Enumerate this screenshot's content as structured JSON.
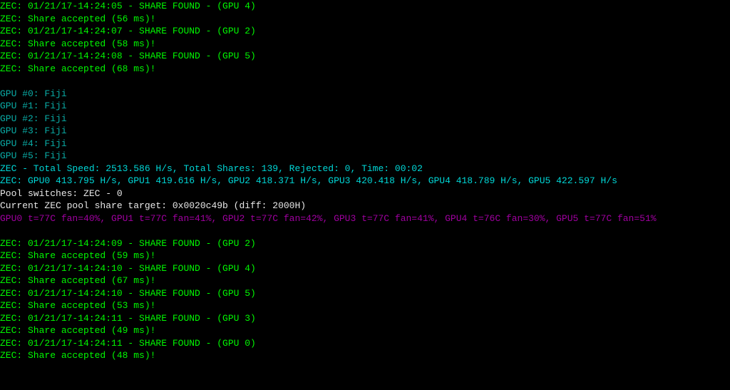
{
  "terminal": {
    "lines": [
      {
        "color": "green",
        "text": "ZEC: 01/21/17-14:24:05 - SHARE FOUND - (GPU 4)"
      },
      {
        "color": "green",
        "text": "ZEC: Share accepted (56 ms)!"
      },
      {
        "color": "green",
        "text": "ZEC: 01/21/17-14:24:07 - SHARE FOUND - (GPU 2)"
      },
      {
        "color": "green",
        "text": "ZEC: Share accepted (58 ms)!"
      },
      {
        "color": "green",
        "text": "ZEC: 01/21/17-14:24:08 - SHARE FOUND - (GPU 5)"
      },
      {
        "color": "green",
        "text": "ZEC: Share accepted (68 ms)!"
      },
      {
        "color": "blank",
        "text": " "
      },
      {
        "color": "teal",
        "text": "GPU #0: Fiji"
      },
      {
        "color": "teal",
        "text": "GPU #1: Fiji"
      },
      {
        "color": "teal",
        "text": "GPU #2: Fiji"
      },
      {
        "color": "teal",
        "text": "GPU #3: Fiji"
      },
      {
        "color": "teal",
        "text": "GPU #4: Fiji"
      },
      {
        "color": "teal",
        "text": "GPU #5: Fiji"
      },
      {
        "color": "cyan",
        "text": "ZEC - Total Speed: 2513.586 H/s, Total Shares: 139, Rejected: 0, Time: 00:02"
      },
      {
        "color": "cyan",
        "text": "ZEC: GPU0 413.795 H/s, GPU1 419.616 H/s, GPU2 418.371 H/s, GPU3 420.418 H/s, GPU4 418.789 H/s, GPU5 422.597 H/s"
      },
      {
        "color": "white",
        "text": "Pool switches: ZEC - 0"
      },
      {
        "color": "white",
        "text": "Current ZEC pool share target: 0x0020c49b (diff: 2000H)"
      },
      {
        "color": "purple",
        "text": "GPU0 t=77C fan=40%, GPU1 t=77C fan=41%, GPU2 t=77C fan=42%, GPU3 t=77C fan=41%, GPU4 t=76C fan=30%, GPU5 t=77C fan=51%"
      },
      {
        "color": "blank",
        "text": " "
      },
      {
        "color": "green",
        "text": "ZEC: 01/21/17-14:24:09 - SHARE FOUND - (GPU 2)"
      },
      {
        "color": "green",
        "text": "ZEC: Share accepted (59 ms)!"
      },
      {
        "color": "green",
        "text": "ZEC: 01/21/17-14:24:10 - SHARE FOUND - (GPU 4)"
      },
      {
        "color": "green",
        "text": "ZEC: Share accepted (67 ms)!"
      },
      {
        "color": "green",
        "text": "ZEC: 01/21/17-14:24:10 - SHARE FOUND - (GPU 5)"
      },
      {
        "color": "green",
        "text": "ZEC: Share accepted (53 ms)!"
      },
      {
        "color": "green",
        "text": "ZEC: 01/21/17-14:24:11 - SHARE FOUND - (GPU 3)"
      },
      {
        "color": "green",
        "text": "ZEC: Share accepted (49 ms)!"
      },
      {
        "color": "green",
        "text": "ZEC: 01/21/17-14:24:11 - SHARE FOUND - (GPU 0)"
      },
      {
        "color": "green",
        "text": "ZEC: Share accepted (48 ms)!"
      }
    ]
  }
}
